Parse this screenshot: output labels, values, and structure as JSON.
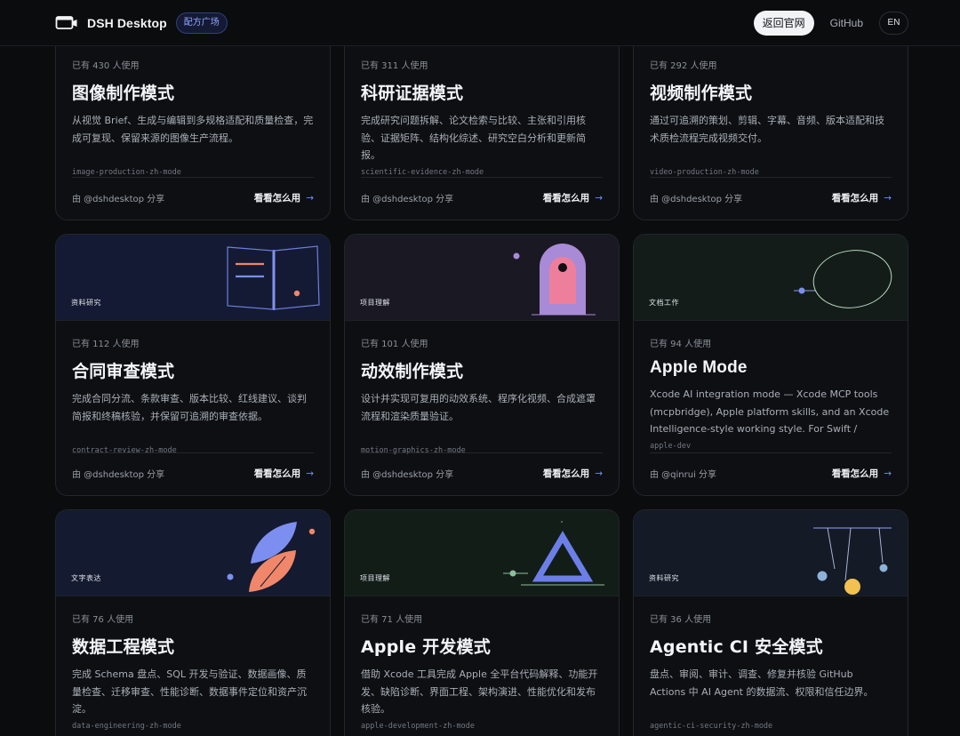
{
  "header": {
    "brand": "DSH Desktop",
    "badge": "配方广场",
    "nav_home": "返回官网",
    "nav_github": "GitHub",
    "nav_lang": "EN"
  },
  "cards": [
    {
      "usage": "已有 430 人使用",
      "title": "图像制作模式",
      "desc": "从视觉 Brief、生成与编辑到多规格适配和质量检查，完成可复现、保留来源的图像生产流程。",
      "slug": "image-production-zh-mode",
      "author": "由 @dshdesktop 分享",
      "cta": "看看怎么用",
      "cover_tag": ""
    },
    {
      "usage": "已有 311 人使用",
      "title": "科研证据模式",
      "desc": "完成研究问题拆解、论文检索与比较、主张和引用核验、证据矩阵、结构化综述、研究空白分析和更新简报。",
      "slug": "scientific-evidence-zh-mode",
      "author": "由 @dshdesktop 分享",
      "cta": "看看怎么用",
      "cover_tag": ""
    },
    {
      "usage": "已有 292 人使用",
      "title": "视频制作模式",
      "desc": "通过可追溯的策划、剪辑、字幕、音频、版本适配和技术质检流程完成视频交付。",
      "slug": "video-production-zh-mode",
      "author": "由 @dshdesktop 分享",
      "cta": "看看怎么用",
      "cover_tag": ""
    },
    {
      "usage": "已有 112 人使用",
      "title": "合同审查模式",
      "desc": "完成合同分流、条款审查、版本比较、红线建议、谈判简报和终稿核验，并保留可追溯的审查依据。",
      "slug": "contract-review-zh-mode",
      "author": "由 @dshdesktop 分享",
      "cta": "看看怎么用",
      "cover_tag": "资料研究"
    },
    {
      "usage": "已有 101 人使用",
      "title": "动效制作模式",
      "desc": "设计并实现可复用的动效系统、程序化视频、合成遮罩流程和渲染质量验证。",
      "slug": "motion-graphics-zh-mode",
      "author": "由 @dshdesktop 分享",
      "cta": "看看怎么用",
      "cover_tag": "项目理解"
    },
    {
      "usage": "已有 94 人使用",
      "title": "Apple Mode",
      "desc": "Xcode AI integration mode — Xcode MCP tools (mcpbridge), Apple platform skills, and an Xcode Intelligence-style working style. For Swift / SwiftUI...",
      "slug": "apple-dev",
      "author": "由 @qinrui 分享",
      "cta": "看看怎么用",
      "cover_tag": "文档工作"
    },
    {
      "usage": "已有 76 人使用",
      "title": "数据工程模式",
      "desc": "完成 Schema 盘点、SQL 开发与验证、数据画像、质量检查、迁移审查、性能诊断、数据事件定位和资产沉淀。",
      "slug": "data-engineering-zh-mode",
      "author": "",
      "cta": "",
      "cover_tag": "文字表达"
    },
    {
      "usage": "已有 71 人使用",
      "title": "Apple 开发模式",
      "desc": "借助 Xcode 工具完成 Apple 全平台代码解释、功能开发、缺陷诊断、界面工程、架构演进、性能优化和发布核验。",
      "slug": "apple-development-zh-mode",
      "author": "",
      "cta": "",
      "cover_tag": "项目理解"
    },
    {
      "usage": "已有 36 人使用",
      "title": "Agentic CI 安全模式",
      "desc": "盘点、审阅、审计、调查、修复并核验 GitHub Actions 中 AI Agent 的数据流、权限和信任边界。",
      "slug": "agentic-ci-security-zh-mode",
      "author": "",
      "cta": "",
      "cover_tag": "资料研究"
    }
  ],
  "colors": {
    "accent": "#6c8cff",
    "cover_contract": "#141a33",
    "cover_motion": "#1a1822",
    "cover_apple": "#131c18",
    "cover_data": "#141a30",
    "cover_apple_dev": "#131d18",
    "cover_ci": "#141a26"
  }
}
